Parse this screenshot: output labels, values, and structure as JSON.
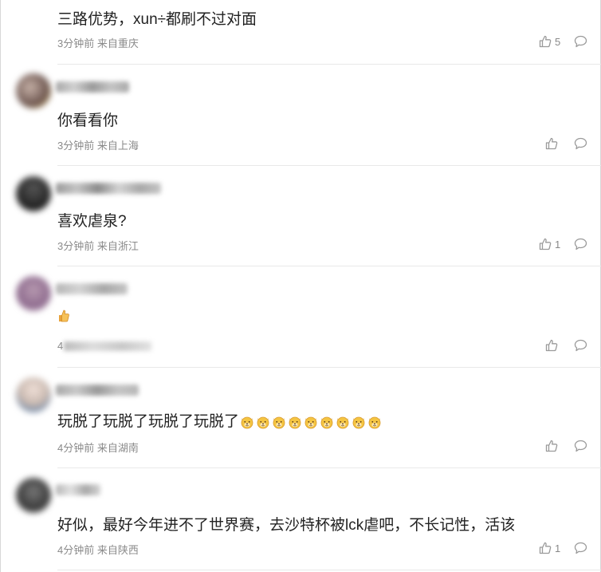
{
  "comments": [
    {
      "text": "三路优势，xun÷都刷不过对面",
      "meta": "3分钟前 来自重庆",
      "likes": "5"
    },
    {
      "text": "你看看你",
      "meta": "3分钟前 来自上海",
      "likes": ""
    },
    {
      "text": "喜欢虐泉?",
      "meta": "3分钟前 来自浙江",
      "likes": "1"
    },
    {
      "text": "",
      "meta": "4",
      "likes": ""
    },
    {
      "text": "玩脱了玩脱了玩脱了玩脱了",
      "meta": "4分钟前 来自湖南",
      "likes": ""
    },
    {
      "text": "好似，最好今年进不了世界赛，去沙特杯被lck虐吧，不长记性，活该",
      "meta": "4分钟前 来自陕西",
      "likes": "1"
    }
  ],
  "colors": {
    "text": "#222222",
    "meta": "#8a8a8a",
    "icon": "#9a9a9a",
    "emoji": "#f5c542"
  },
  "icons": {
    "like": "thumbs-up-icon",
    "reply": "comment-bubble-icon",
    "emoji": "dog-face-emoji-icon",
    "thumb_emoji": "thumbs-up-emoji-icon"
  }
}
